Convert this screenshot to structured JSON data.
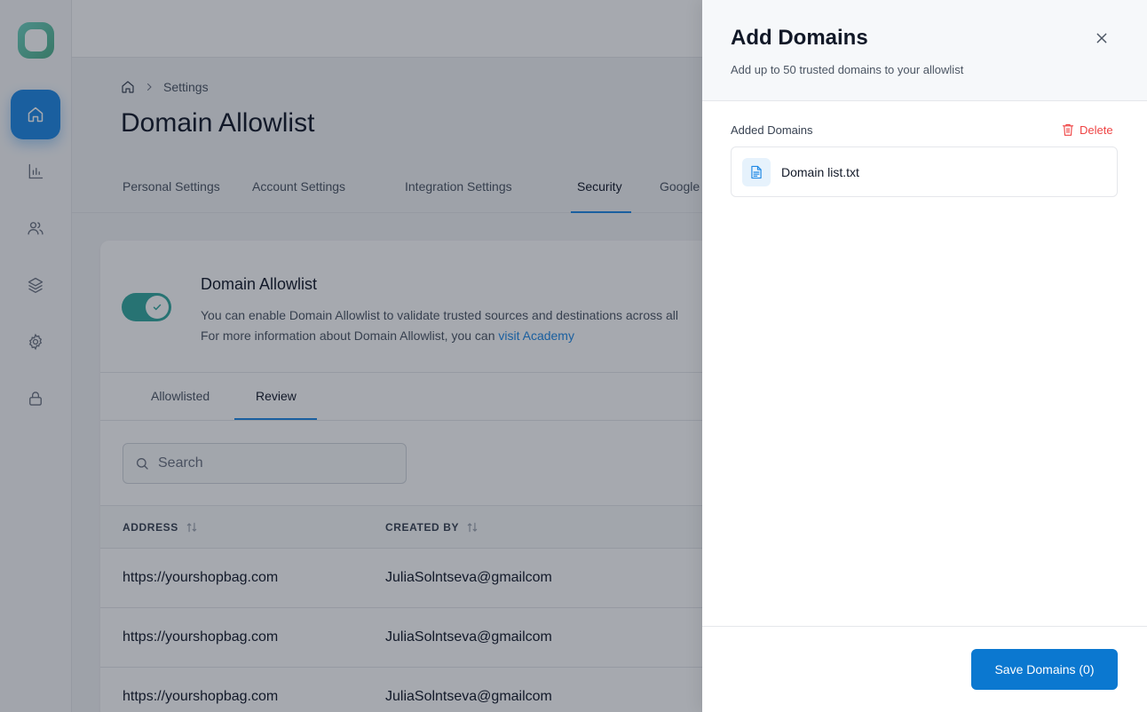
{
  "breadcrumb": {
    "current": "Settings"
  },
  "page": {
    "title": "Domain Allowlist"
  },
  "settings_tabs": [
    {
      "label": "Personal Settings"
    },
    {
      "label": "Account Settings"
    },
    {
      "label": "Integration Settings"
    },
    {
      "label": "Security"
    },
    {
      "label": "Google"
    }
  ],
  "active_settings_tab": "Security",
  "allowlist": {
    "title": "Domain Allowlist",
    "description_line1": "You can enable Domain Allowlist to validate trusted sources and destinations across all",
    "description_line2_prefix": "For more information about Domain Allowlist, you can ",
    "link_text": "visit Academy",
    "enabled": true
  },
  "subtabs": [
    {
      "label": "Allowlisted"
    },
    {
      "label": "Review"
    }
  ],
  "active_subtab": "Review",
  "search": {
    "placeholder": "Search"
  },
  "table": {
    "headers": [
      "ADDRESS",
      "CREATED BY"
    ],
    "rows": [
      [
        "https://yourshopbag.com",
        "JuliaSolntseva@gmailcom"
      ],
      [
        "https://yourshopbag.com",
        "JuliaSolntseva@gmailcom"
      ],
      [
        "https://yourshopbag.com",
        "JuliaSolntseva@gmailcom"
      ]
    ]
  },
  "drawer": {
    "title": "Add Domains",
    "subtitle": "Add up to 50 trusted domains to your allowlist",
    "added_label": "Added Domains",
    "delete_label": "Delete",
    "file_name": "Domain list.txt",
    "save_label": "Save Domains (0)"
  },
  "sidebar": {
    "items": [
      {
        "icon": "home-icon"
      },
      {
        "icon": "chart-icon"
      },
      {
        "icon": "users-icon"
      },
      {
        "icon": "layers-icon"
      },
      {
        "icon": "gear-icon"
      },
      {
        "icon": "lock-icon"
      }
    ]
  },
  "colors": {
    "accent": "#1e88e5",
    "toggle": "#32a99e",
    "danger": "#ef4444",
    "save_button": "#0b78d0"
  }
}
